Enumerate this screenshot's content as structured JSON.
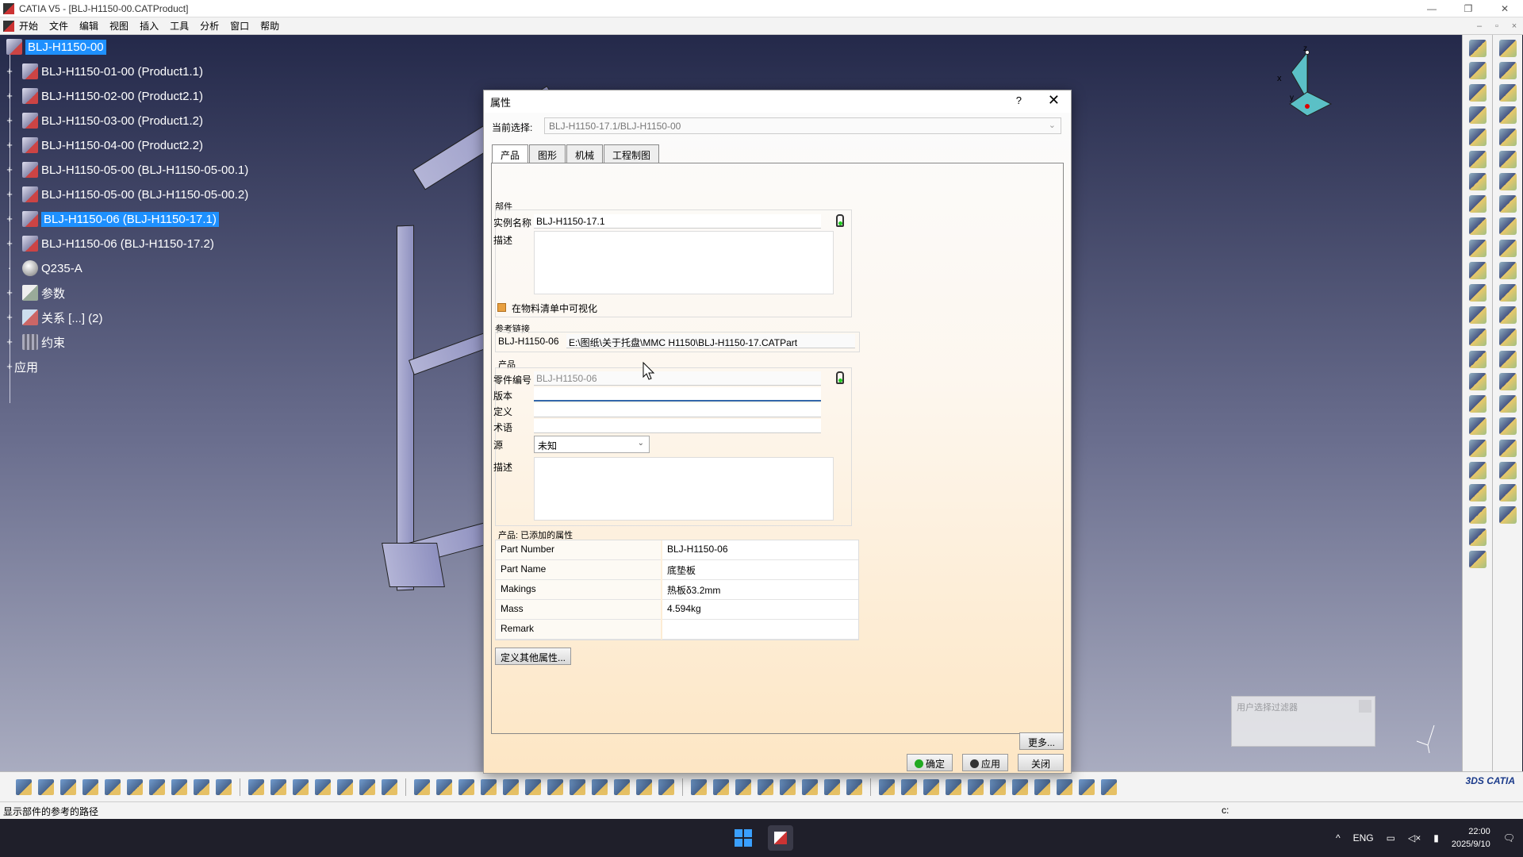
{
  "window": {
    "title": "CATIA V5 - [BLJ-H1150-00.CATProduct]",
    "controls": [
      "—",
      "❐",
      "✕"
    ]
  },
  "menu": {
    "items": [
      "开始",
      "文件",
      "编辑",
      "视图",
      "插入",
      "工具",
      "分析",
      "窗口",
      "帮助"
    ]
  },
  "tree": {
    "items": [
      {
        "label": "BLJ-H1150-00",
        "selected": true
      },
      {
        "label": "BLJ-H1150-01-00 (Product1.1)"
      },
      {
        "label": "BLJ-H1150-02-00 (Product2.1)"
      },
      {
        "label": "BLJ-H1150-03-00 (Product1.2)"
      },
      {
        "label": "BLJ-H1150-04-00 (Product2.2)"
      },
      {
        "label": "BLJ-H1150-05-00 (BLJ-H1150-05-00.1)"
      },
      {
        "label": "BLJ-H1150-05-00 (BLJ-H1150-05-00.2)"
      },
      {
        "label": "BLJ-H1150-06 (BLJ-H1150-17.1)",
        "selected": true
      },
      {
        "label": "BLJ-H1150-06 (BLJ-H1150-17.2)"
      },
      {
        "label": "Q235-A"
      },
      {
        "label": "参数"
      },
      {
        "label": "关系 [...] (2)"
      },
      {
        "label": "约束"
      },
      {
        "label": "应用"
      }
    ]
  },
  "compass": {
    "x": "x",
    "y": "y",
    "z": "z"
  },
  "dialog": {
    "title": "属性",
    "help": "?",
    "close": "✕",
    "current_selection_label": "当前选择:",
    "current_selection_value": "BLJ-H1150-17.1/BLJ-H1150-00",
    "tabs": [
      "产品",
      "图形",
      "机械",
      "工程制图"
    ],
    "component": {
      "group_label": "部件",
      "instance_name_label": "实例名称",
      "instance_name_value": "BLJ-H1150-17.1",
      "description_label": "描述",
      "bom_visible_label": "在物料清单中可视化"
    },
    "reference_link": {
      "group_label": "参考链接",
      "name": "BLJ-H1150-06",
      "path": "E:\\图纸\\关于托盘\\MMC H1150\\BLJ-H1150-17.CATPart"
    },
    "product": {
      "group_label": "产品",
      "part_number_label": "零件编号",
      "part_number_value": "BLJ-H1150-06",
      "revision_label": "版本",
      "definition_label": "定义",
      "nomenclature_label": "术语",
      "source_label": "源",
      "source_value": "未知",
      "description_label": "描述"
    },
    "added_properties": {
      "group_label": "产品: 已添加的属性",
      "rows": [
        {
          "key": "Part  Number",
          "value": "BLJ-H1150-06"
        },
        {
          "key": "Part  Name",
          "value": "底垫板"
        },
        {
          "key": "Makings",
          "value": "热板δ3.2mm"
        },
        {
          "key": "Mass",
          "value": "4.594kg"
        },
        {
          "key": "Remark",
          "value": ""
        }
      ]
    },
    "define_other_button": "定义其他属性...",
    "more_button": "更多...",
    "ok_button": "确定",
    "apply_button": "应用",
    "close_button": "关闭"
  },
  "user_filter": {
    "title": "用户选择过滤器"
  },
  "status_bar": {
    "message": "显示部件的参考的路径",
    "command": "c:"
  },
  "taskbar": {
    "ime": "ENG",
    "time": "22:00",
    "date": "2025/9/10"
  },
  "colors": {
    "selection": "#1e90ff",
    "viewport_top": "#24294a",
    "viewport_bottom": "#a9acc0"
  }
}
